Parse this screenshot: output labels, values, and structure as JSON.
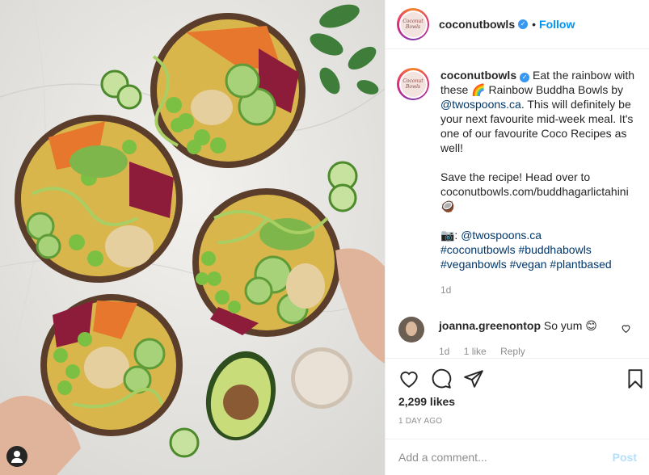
{
  "post": {
    "username": "coconutbowls",
    "verified": true,
    "follow_label": "Follow",
    "avatar_text": "Coconut Bowls",
    "caption": {
      "username": "coconutbowls",
      "line1": "Eat the rainbow with these",
      "emoji_rainbow": "🌈",
      "line2": "Rainbow Buddha Bowls by",
      "mention": "@twospoons.ca",
      "line3": ". This will definitely be your next favourite mid-week meal. It's one of our favourite Coco Recipes as well!",
      "para2": "Save the recipe! Head over to",
      "url": "coconutbowls.com/buddhagarlictahini",
      "emoji_coconut": "🥥",
      "camera_emoji": "📷:",
      "credit": "@twospoons.ca",
      "hashtags_1": "#coconutbowls #buddhabowls",
      "hashtags_2": "#veganbowls #vegan #plantbased",
      "time": "1d"
    },
    "comment": {
      "username": "joanna.greenontop",
      "text": "So yum",
      "emoji": "😊",
      "time": "1d",
      "likes": "1 like",
      "reply_label": "Reply"
    },
    "likes_count": "2,299 likes",
    "posted_ago": "1 DAY AGO",
    "add_comment_placeholder": "Add a comment...",
    "post_label": "Post"
  },
  "icons": {
    "like": "heart-icon",
    "comment": "comment-icon",
    "share": "share-icon",
    "save": "bookmark-icon",
    "comment_like": "heart-icon",
    "tagged": "user-tag-icon"
  },
  "colors": {
    "accent": "#0095f6",
    "verified": "#3897f0",
    "text": "#262626",
    "muted": "#8e8e8e",
    "link": "#00376b",
    "post_disabled": "#b2dffc"
  }
}
